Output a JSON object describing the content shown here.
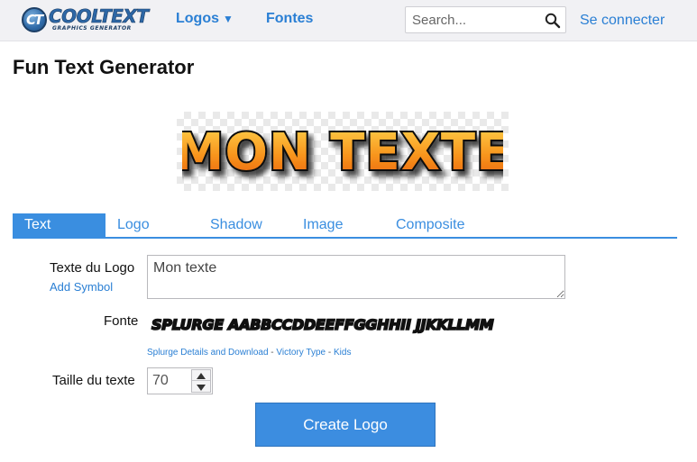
{
  "header": {
    "logo_text": "COOLTEXT",
    "logo_subtext": "GRAPHICS GENERATOR",
    "nav_logos": "Logos",
    "nav_fontes": "Fontes",
    "search_placeholder": "Search...",
    "signin": "Se connecter"
  },
  "page": {
    "title": "Fun Text Generator",
    "preview_text": "MON TEXTE"
  },
  "tabs": [
    {
      "label": "Text",
      "active": true
    },
    {
      "label": "Logo",
      "active": false
    },
    {
      "label": "Shadow",
      "active": false
    },
    {
      "label": "Image",
      "active": false
    },
    {
      "label": "Composite",
      "active": false
    }
  ],
  "form": {
    "logo_text_label": "Texte du Logo",
    "add_symbol": "Add Symbol",
    "logo_text_value": "Mon texte",
    "font_label": "Fonte",
    "font_sample": "SPLURGE AABBCCDDEEFFGGHHII JJKKLLMM",
    "font_links": {
      "details": "Splurge Details and Download",
      "sep1": " - ",
      "foundry": "Victory Type",
      "sep2": " - ",
      "category": "Kids"
    },
    "size_label": "Taille du texte",
    "size_value": "70",
    "create_button": "Create Logo"
  },
  "colors": {
    "accent": "#3a8ee0",
    "nav_bg": "#f1f1f4",
    "preview_orange": "#f7941d"
  },
  "icons": {
    "search": "search-icon",
    "spin_up": "chevron-up-icon",
    "spin_down": "chevron-down-icon"
  }
}
